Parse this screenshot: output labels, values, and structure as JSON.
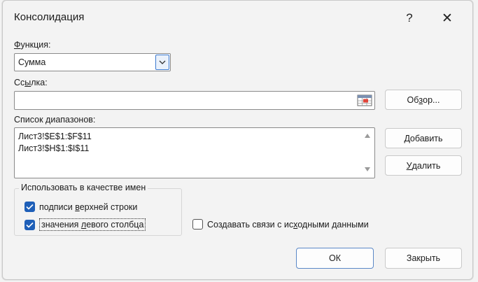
{
  "dialog": {
    "title": "Консолидация",
    "help_glyph": "?",
    "close_glyph": "✕"
  },
  "function": {
    "label_ul": "Ф",
    "label_rest": "ункция:",
    "selected": "Сумма"
  },
  "reference": {
    "label_pre": "Сс",
    "label_ul": "ы",
    "label_post": "лка:",
    "value": "",
    "browse_pre": "Об",
    "browse_ul": "з",
    "browse_post": "ор..."
  },
  "ranges": {
    "label": "Список диапазонов:",
    "items": [
      "Лист3!$E$1:$F$11",
      "Лист3!$H$1:$I$11"
    ],
    "add_pre": "",
    "add_ul": "Д",
    "add_post": "обавить",
    "delete_pre": "",
    "delete_ul": "У",
    "delete_post": "далить"
  },
  "use_labels": {
    "title": "Использовать в качестве имен",
    "top_row": {
      "pre": "подписи ",
      "ul": "в",
      "post": "ерхней строки",
      "checked": true
    },
    "left_column": {
      "pre": "значения ",
      "ul": "л",
      "post": "евого столбца",
      "checked": true
    }
  },
  "links": {
    "pre": "Создавать связи с ис",
    "ul": "х",
    "post": "одными данными",
    "checked": false
  },
  "footer": {
    "ok": "ОК",
    "close": "Закрыть"
  },
  "colors": {
    "accent": "#1e5fb8",
    "background": "#f3f3f3"
  },
  "icons": [
    "help-icon",
    "close-icon",
    "chevron-down-icon",
    "range-select-icon",
    "scroll-up-icon",
    "scroll-down-icon",
    "checkmark-icon"
  ]
}
